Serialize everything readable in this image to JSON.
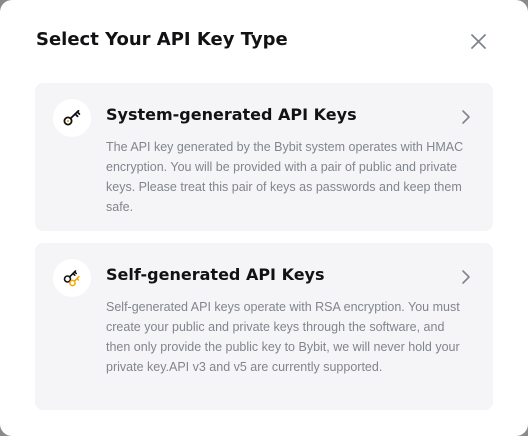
{
  "dialog": {
    "title": "Select Your API Key Type",
    "close_icon": "close-icon"
  },
  "options": [
    {
      "title": "System-generated API Keys",
      "description": "The API key generated by the Bybit system operates with HMAC encryption. You will be provided with a pair of public and private keys. Please treat this pair of keys as passwords and keep them safe.",
      "icon": "key-icon"
    },
    {
      "title": "Self-generated API Keys",
      "description": "Self-generated API keys operate with RSA encryption. You must create your public and private keys through the software, and then only provide the public key to Bybit, we will never hold your private key.API v3 and v5 are currently supported.",
      "icon": "keys-pair-icon"
    }
  ],
  "colors": {
    "background": "#ffffff",
    "card_background": "#f5f5f7",
    "title_text": "#121214",
    "body_text": "#81858c",
    "accent": "#f7a600"
  }
}
